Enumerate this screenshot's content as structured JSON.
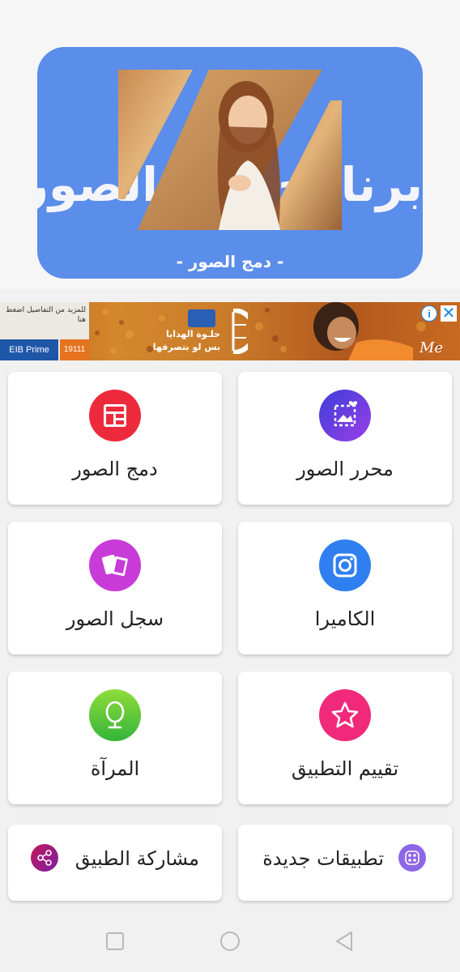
{
  "banner": {
    "title": "برنامج دمج الصور",
    "subtitle": "- دمج الصور -"
  },
  "ad": {
    "top_text": "للمزيد من التفاصيل اضغط هنا",
    "eib_label": "EIB Prime",
    "hotline": "19111",
    "promo_line1": "حلـوة الهدايا",
    "promo_line2": "بس لو بتصرفها",
    "brand_mark": "Me",
    "info_symbol": "i",
    "close_symbol": "✕"
  },
  "cards": {
    "photo_editor": {
      "label": "محرر الصور",
      "icon": "photo-editor-icon",
      "color": "#6a3de8"
    },
    "photo_merge": {
      "label": "دمج الصور",
      "icon": "collage-icon",
      "color": "#ec2a3b"
    },
    "camera": {
      "label": "الكاميرا",
      "icon": "camera-icon",
      "color": "#2f7ff0"
    },
    "photo_history": {
      "label": "سجل الصور",
      "icon": "photos-stack-icon",
      "color": "#c83bd8"
    },
    "rate_app": {
      "label": "تقييم التطبيق",
      "icon": "star-icon",
      "color": "#f0297a"
    },
    "mirror": {
      "label": "المرآة",
      "icon": "mirror-icon",
      "color": "#5fcb35"
    },
    "new_apps": {
      "label": "تطبيقات جديدة",
      "icon": "apps-icon",
      "color": "#8d67e6"
    },
    "share_app": {
      "label": "مشاركة الطبيق",
      "icon": "share-icon",
      "color": "#a0217a"
    }
  }
}
